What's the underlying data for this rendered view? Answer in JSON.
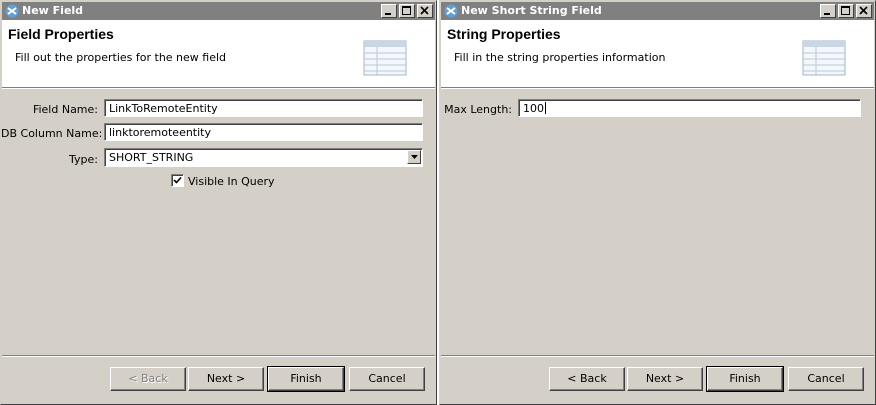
{
  "left_dialog": {
    "title": "New Field",
    "header": {
      "title": "Field Properties",
      "description": "Fill out the properties for the new field"
    },
    "fields": {
      "field_name": {
        "label": "Field Name:",
        "value": "LinkToRemoteEntity"
      },
      "db_column_name": {
        "label": "DB Column Name:",
        "value": "linktoremoteentity"
      },
      "type": {
        "label": "Type:",
        "value": "SHORT_STRING"
      }
    },
    "visible_in_query": {
      "label": "Visible In Query",
      "checked": true
    },
    "buttons": {
      "back": "< Back",
      "next": "Next >",
      "finish": "Finish",
      "cancel": "Cancel"
    }
  },
  "right_dialog": {
    "title": "New Short String Field",
    "header": {
      "title": "String Properties",
      "description": "Fill in the string properties information"
    },
    "fields": {
      "max_length": {
        "label": "Max Length:",
        "value": "100"
      }
    },
    "buttons": {
      "back": "< Back",
      "next": "Next >",
      "finish": "Finish",
      "cancel": "Cancel"
    }
  },
  "colors": {
    "inactive_titlebar": "#808080",
    "dialog_face": "#d4d0c8",
    "header_bg": "#ffffff"
  }
}
